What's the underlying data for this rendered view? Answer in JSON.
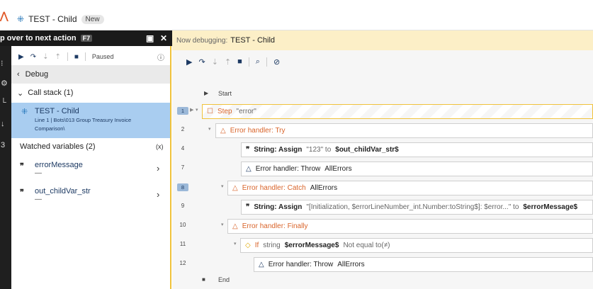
{
  "window": {
    "title": "TEST - Child",
    "badge": "New"
  },
  "tooltip": {
    "text": "p over to next action",
    "key": "F7"
  },
  "left_toolbar": {
    "status": "Paused"
  },
  "debug_header": {
    "label": "Debug"
  },
  "call_stack": {
    "label": "Call stack (1)",
    "item": {
      "name": "TEST - Child",
      "line": "Line 1  |  Bots\\013 Group Treasury Invoice",
      "line2": "Comparison\\"
    }
  },
  "watched": {
    "label": "Watched variables (2)",
    "fx_label": "(x)",
    "vars": [
      {
        "name": "errorMessage",
        "value": "—"
      },
      {
        "name": "out_childVar_str",
        "value": "—"
      }
    ]
  },
  "right": {
    "banner_label": "Now debugging:",
    "banner_value": "TEST - Child"
  },
  "flow": {
    "start": "Start",
    "end": "End",
    "lines": [
      {
        "num": "1",
        "head": "Step",
        "rest": "\"error\""
      },
      {
        "num": "2",
        "head": "Error handler: Try",
        "rest": ""
      },
      {
        "num": "4",
        "head": "String: Assign",
        "rest": "\"123\" to",
        "var": "$out_childVar_str$"
      },
      {
        "num": "7",
        "head": "Error handler: Throw",
        "rest": "AllErrors"
      },
      {
        "num": "8",
        "head": "Error handler: Catch",
        "rest": "AllErrors"
      },
      {
        "num": "9",
        "head": "String: Assign",
        "rest": "\"[Initialization, $errorLineNumber_int.Number:toString$]: $error...\" to",
        "var": "$errorMessage$"
      },
      {
        "num": "10",
        "head": "Error handler: Finally",
        "rest": ""
      },
      {
        "num": "11",
        "head": "If",
        "pre": "string",
        "var": "$errorMessage$",
        "rest": "Not equal to(≠)"
      },
      {
        "num": "12",
        "head": "Error handler: Throw",
        "rest": "AllErrors"
      }
    ]
  }
}
